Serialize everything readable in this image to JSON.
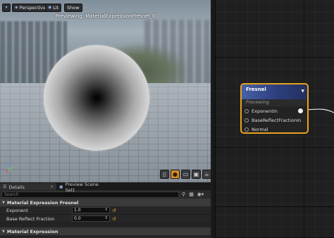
{
  "viewport": {
    "toolbar": {
      "menu_glyph": "▾",
      "perspective_label": "Perspective",
      "lit_label": "Lit",
      "show_label": "Show"
    },
    "preview_label": "Previewing: MaterialExpressionFresnel_0",
    "axes": {
      "x": "x",
      "y": "y",
      "z": "z"
    },
    "preview_shapes": [
      {
        "icon": "cylinder-icon",
        "glyph": "▯"
      },
      {
        "icon": "sphere-icon",
        "glyph": "●",
        "active": true
      },
      {
        "icon": "plane-icon",
        "glyph": "▭"
      },
      {
        "icon": "cube-icon",
        "glyph": "▣"
      },
      {
        "icon": "teapot-icon",
        "glyph": "☕"
      }
    ]
  },
  "details": {
    "tabs": [
      {
        "label": "Details",
        "active": true
      },
      {
        "label": "Preview Scene Sett",
        "active": false
      }
    ],
    "search": {
      "placeholder": "Search"
    },
    "sections": [
      {
        "title": "Material Expression Fresnel",
        "properties": [
          {
            "name": "Exponent",
            "value": "1.0"
          },
          {
            "name": "Base Reflect Fraction",
            "value": "0.0"
          }
        ]
      },
      {
        "title": "Material Expression",
        "properties": []
      }
    ]
  },
  "graph": {
    "node": {
      "title": "Fresnel",
      "subtitle": "Previewing",
      "inputs": [
        "ExponentIn",
        "BaseReflectFractionIn",
        "Normal"
      ]
    }
  },
  "colors": {
    "selection_outline": "#e7a21f",
    "node_header": "#3b55a0",
    "graph_background": "#1f1f1f"
  }
}
